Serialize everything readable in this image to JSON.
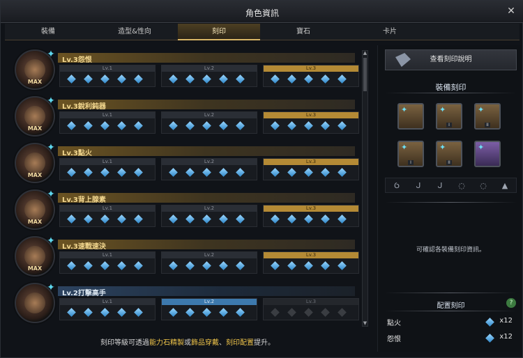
{
  "window": {
    "title": "角色資訊",
    "close_icon": "close-icon"
  },
  "tabs": [
    {
      "label": "裝備"
    },
    {
      "label": "造型&性向"
    },
    {
      "label": "刻印"
    },
    {
      "label": "寶石"
    },
    {
      "label": "卡片"
    }
  ],
  "active_tab": "刻印",
  "engravings": [
    {
      "title": "Lv.3怨恨",
      "max": "MAX",
      "active_level": 3,
      "style": "gold"
    },
    {
      "title": "Lv.3銳利鈍器",
      "max": "MAX",
      "active_level": 3,
      "style": "gold"
    },
    {
      "title": "Lv.3點火",
      "max": "MAX",
      "active_level": 3,
      "style": "gold"
    },
    {
      "title": "Lv.3背上腺素",
      "max": "MAX",
      "active_level": 3,
      "style": "gold"
    },
    {
      "title": "Lv.3速戰速決",
      "max": "MAX",
      "active_level": 3,
      "style": "gold"
    },
    {
      "title": "Lv.2打擊高手",
      "max": "",
      "active_level": 2,
      "style": "blue"
    }
  ],
  "levels": [
    "Lv.1",
    "Lv.2",
    "Lv.3"
  ],
  "hint": {
    "p1": "刻印等級可透過",
    "y1": "能力石精製",
    "p2": "或",
    "y2": "飾品穿戴",
    "p3": "、",
    "y3": "刻印配置",
    "p4": "提升。"
  },
  "side": {
    "desc_button": "查看刻印說明",
    "equip_title": "裝備刻印",
    "info": "可確認各裝備刻印資訊。",
    "config_title": "配置刻印",
    "help": "?",
    "config": [
      {
        "name": "點火",
        "count": "x12"
      },
      {
        "name": "怨恨",
        "count": "x12"
      }
    ]
  },
  "equip": [
    {
      "pip": ""
    },
    {
      "pip": "I"
    },
    {
      "pip": "II"
    },
    {
      "pip": "I"
    },
    {
      "pip": "II"
    },
    {
      "pip": ""
    }
  ],
  "slot_icons": [
    "necklace-icon",
    "earring-I-icon",
    "earring-II-icon",
    "ring-I-icon",
    "ring-II-icon",
    "stone-icon"
  ]
}
